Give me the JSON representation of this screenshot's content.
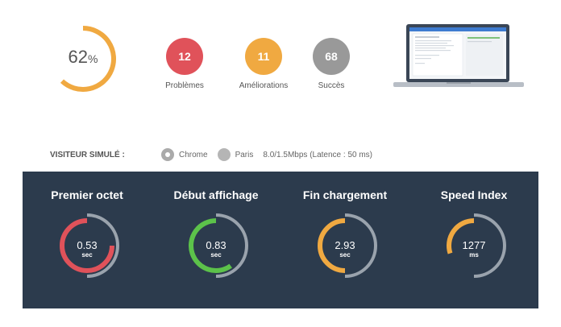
{
  "score": {
    "value": "62",
    "suffix": "%",
    "fraction": 0.62,
    "color": "#f0a941"
  },
  "summary": [
    {
      "count": "12",
      "label": "Problèmes",
      "color": "#e0525a"
    },
    {
      "count": "11",
      "label": "Améliorations",
      "color": "#f0a941"
    },
    {
      "count": "68",
      "label": "Succès",
      "color": "#999999"
    }
  ],
  "visitor": {
    "label": "VISITEUR SIMULÉ :",
    "browser": "Chrome",
    "browser_icon": "chrome-icon",
    "location": "Paris",
    "location_icon": "globe-icon",
    "connection": "8.0/1.5Mbps (Latence : 50 ms)"
  },
  "metrics": [
    {
      "title": "Premier octet",
      "value": "0.53",
      "unit": "sec",
      "color": "#e0525a",
      "fraction": 0.75
    },
    {
      "title": "Début affichage",
      "value": "0.83",
      "unit": "sec",
      "color": "#5cc24a",
      "fraction": 0.6
    },
    {
      "title": "Fin chargement",
      "value": "2.93",
      "unit": "sec",
      "color": "#f0a941",
      "fraction": 0.5
    },
    {
      "title": "Speed Index",
      "value": "1277",
      "unit": "ms",
      "color": "#f0a941",
      "fraction": 0.3
    }
  ],
  "panel_bg": "#2c3b4d",
  "track_color": "#9aa3ad"
}
